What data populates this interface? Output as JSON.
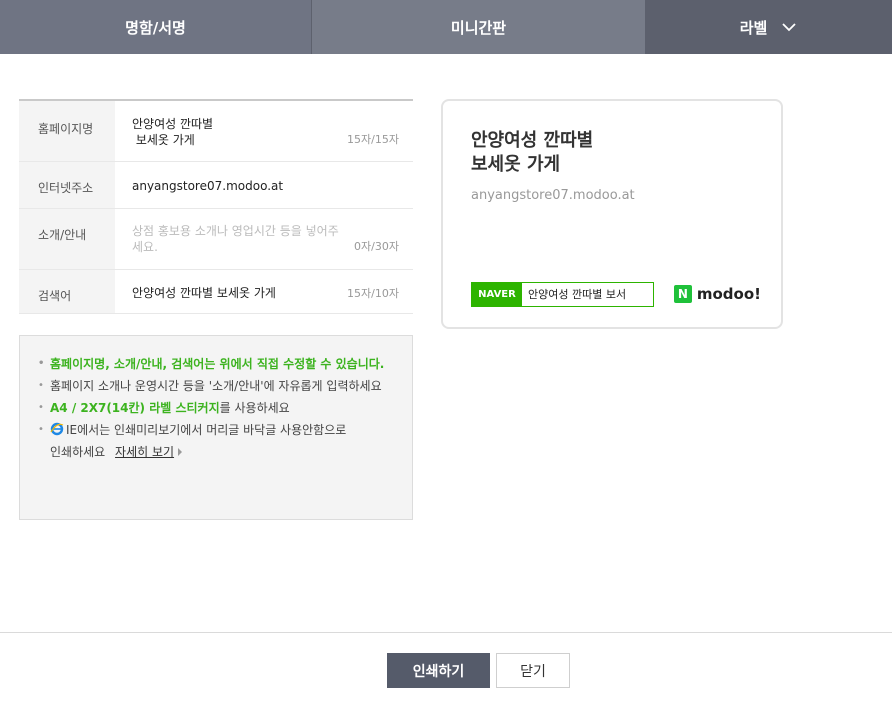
{
  "tabs": [
    {
      "label": "명함/서명"
    },
    {
      "label": "미니간판"
    },
    {
      "label": "라벨"
    }
  ],
  "form": {
    "homepage_name": {
      "label": "홈페이지명",
      "line1": "안양여성 깐따별",
      "line2": " 보세옷 가게",
      "count": "15자/15자"
    },
    "url": {
      "label": "인터넷주소",
      "value": "anyangstore07.modoo.at"
    },
    "intro": {
      "label": "소개/안내",
      "placeholder": "상점 홍보용 소개나 영업시간 등을 넣어주세요.",
      "count": "0자/30자"
    },
    "keyword": {
      "label": "검색어",
      "value": "안양여성 깐따별 보세옷 가게",
      "count": "15자/10자"
    }
  },
  "notice": {
    "item1": "홈페이지명, 소개/안내, 검색어는 위에서 직접 수정할 수 있습니다.",
    "item2": "홈페이지 소개나 운영시간 등을 '소개/안내'에 자유롭게 입력하세요",
    "item3_green": "A4 / 2X7(14칸) 라벨 스티커지",
    "item3_rest": "를 사용하세요",
    "item4_a": "IE에서는 인쇄미리보기에서 머리글 바닥글 사용안함으로",
    "item4_b": "인쇄하세요",
    "more_link": "자세히 보기"
  },
  "preview": {
    "title_line1": "안양여성 깐따별",
    "title_line2": "보세옷 가게",
    "url": "anyangstore07.modoo.at",
    "naver_badge": "NAVER",
    "naver_text": "안양여성 깐따별 보서",
    "logo_letter": "N",
    "logo_text": "modoo!"
  },
  "buttons": {
    "print": "인쇄하기",
    "close": "닫기"
  },
  "colors": {
    "accent_green": "#2db400",
    "tab_bg": "#6f7483",
    "print_button": "#555b6a"
  }
}
